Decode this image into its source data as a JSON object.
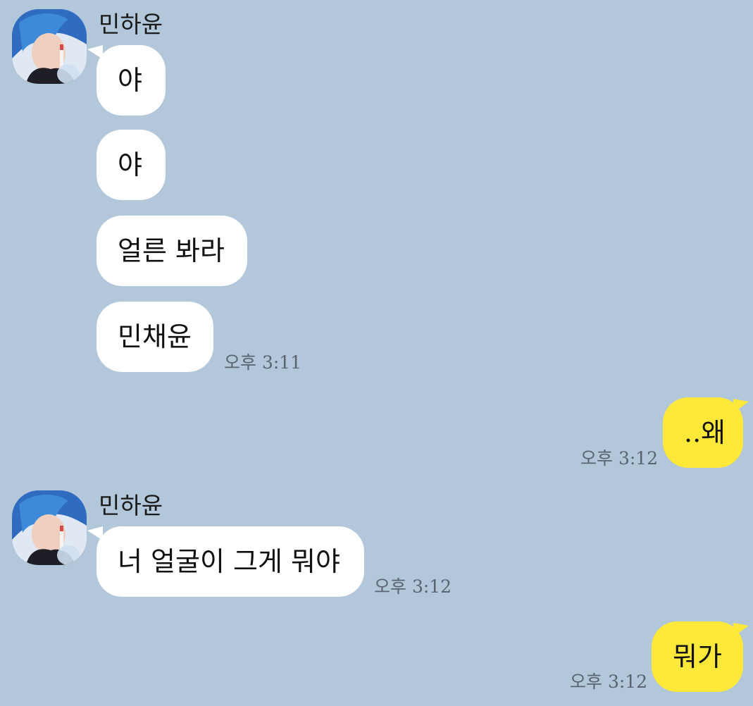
{
  "sender": {
    "name": "민하윤",
    "avatar_icon": "profile-photo-icon"
  },
  "colors": {
    "background": "#b2c7da",
    "incoming_bubble": "#ffffff",
    "outgoing_bubble": "#fee83a"
  },
  "messages": [
    {
      "text": "야"
    },
    {
      "text": "야"
    },
    {
      "text": "얼른 봐라"
    },
    {
      "text": "민채윤",
      "time": "오후 3:11"
    },
    {
      "text": "..왜",
      "time": "오후 3:12"
    },
    {
      "text": "너 얼굴이 그게 뭐야",
      "time": "오후 3:12"
    },
    {
      "text": "뭐가",
      "time": "오후 3:12"
    }
  ]
}
